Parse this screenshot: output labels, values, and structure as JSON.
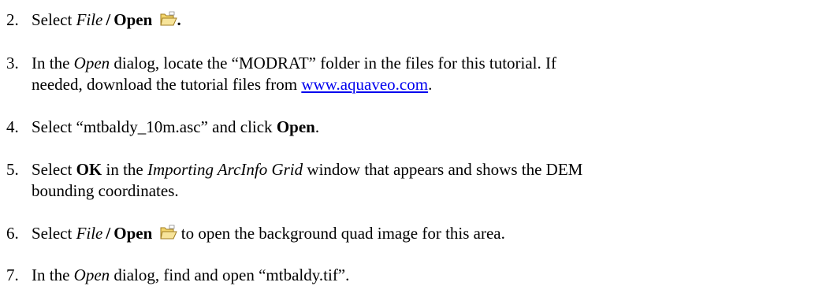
{
  "steps": [
    {
      "num": "2.",
      "pre": "Select ",
      "menu": "File",
      "sep": "/",
      "cmd": "Open",
      "post": "."
    },
    {
      "num": "3.",
      "p1": "In the ",
      "dialog": "Open",
      "p2": " dialog, locate the “MODRAT” folder in the files for this tutorial. If",
      "p3": "needed, download the tutorial files from ",
      "link": "www.aquaveo.com",
      "p4": "."
    },
    {
      "num": "4.",
      "p1": "Select “mtbaldy_10m.asc” and click ",
      "cmd": "Open",
      "p2": "."
    },
    {
      "num": "5.",
      "p1": "Select ",
      "cmd": "OK",
      "p2": " in the ",
      "win": "Importing ArcInfo Grid",
      "p3": " window that appears and shows the DEM",
      "p4": "bounding coordinates."
    },
    {
      "num": "6.",
      "pre": "Select ",
      "menu": "File",
      "sep": "/",
      "cmd": "Open",
      "post": " to open the background quad image for this area."
    },
    {
      "num": "7.",
      "p1": "In the ",
      "dialog": "Open",
      "p2": " dialog, find and open “mtbaldy.tif”."
    }
  ],
  "icons": {
    "open": "folder-open-icon"
  }
}
